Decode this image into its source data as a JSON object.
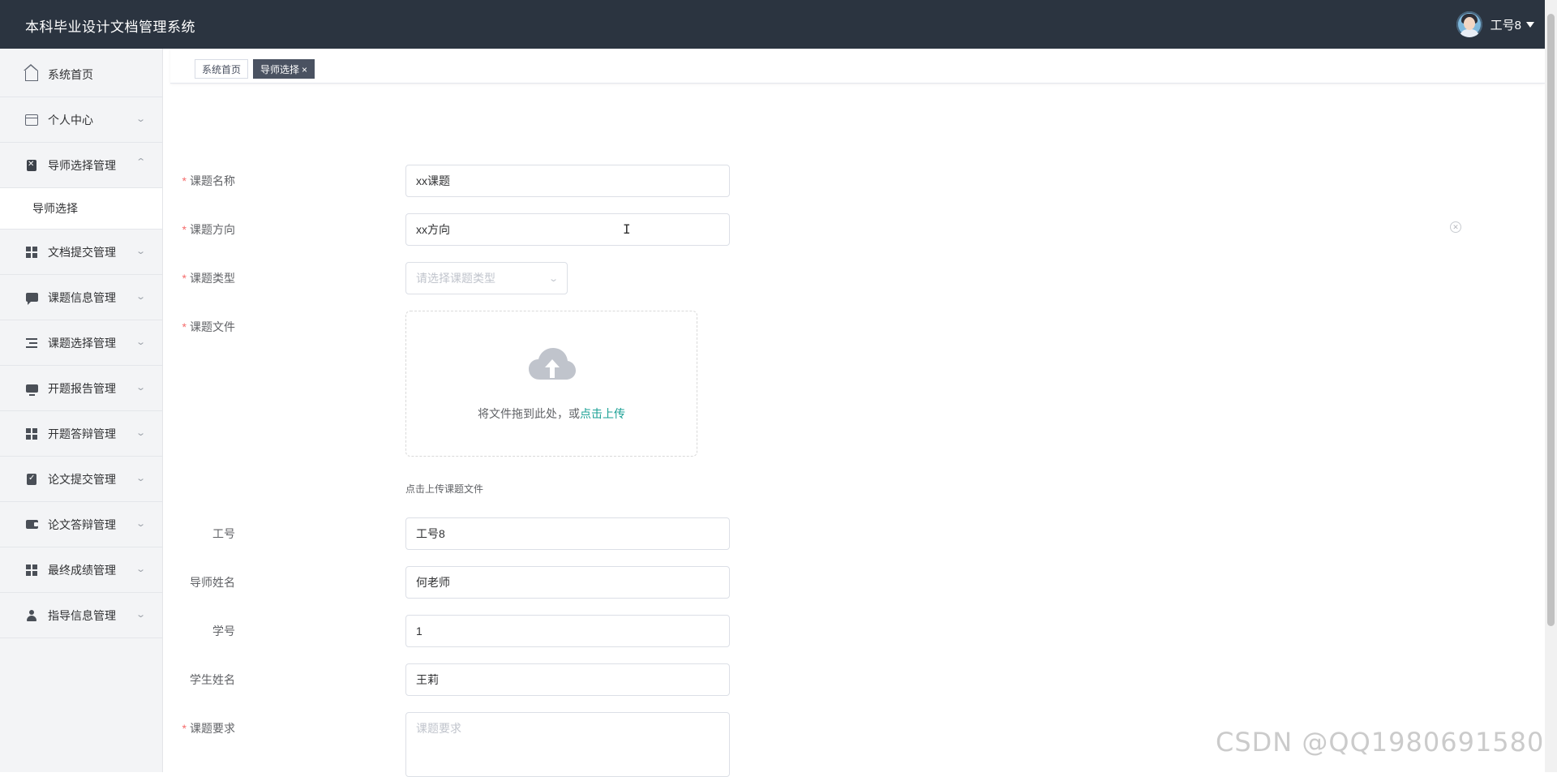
{
  "app": {
    "title": "本科毕业设计文档管理系统"
  },
  "user": {
    "name": "工号8"
  },
  "sidebar": {
    "items": [
      {
        "label": "系统首页",
        "icon": "home-icon",
        "expandable": false
      },
      {
        "label": "个人中心",
        "icon": "card-icon",
        "expandable": true
      },
      {
        "label": "导师选择管理",
        "icon": "clipboard-icon",
        "expandable": true,
        "expanded": true,
        "children": [
          {
            "label": "导师选择"
          }
        ]
      },
      {
        "label": "文档提交管理",
        "icon": "grid-icon",
        "expandable": true
      },
      {
        "label": "课题信息管理",
        "icon": "chat-icon",
        "expandable": true
      },
      {
        "label": "课题选择管理",
        "icon": "list-icon",
        "expandable": true
      },
      {
        "label": "开题报告管理",
        "icon": "monitor-icon",
        "expandable": true
      },
      {
        "label": "开题答辩管理",
        "icon": "grid-icon",
        "expandable": true
      },
      {
        "label": "论文提交管理",
        "icon": "check-clipboard-icon",
        "expandable": true
      },
      {
        "label": "论文答辩管理",
        "icon": "wallet-icon",
        "expandable": true
      },
      {
        "label": "最终成绩管理",
        "icon": "grid-icon",
        "expandable": true
      },
      {
        "label": "指导信息管理",
        "icon": "user-icon",
        "expandable": true
      }
    ]
  },
  "tabs": [
    {
      "label": "系统首页",
      "active": false
    },
    {
      "label": "导师选择",
      "active": true,
      "close": "×"
    }
  ],
  "form": {
    "topic_name": {
      "label": "课题名称",
      "required": true,
      "value": "xx课题"
    },
    "topic_direction": {
      "label": "课题方向",
      "required": true,
      "value": "xx方向"
    },
    "topic_type": {
      "label": "课题类型",
      "required": true,
      "placeholder": "请选择课题类型"
    },
    "topic_file": {
      "label": "课题文件",
      "required": true,
      "drop_text": "将文件拖到此处，或",
      "click_text": "点击上传",
      "tip": "点击上传课题文件"
    },
    "staff_id": {
      "label": "工号",
      "value": "工号8"
    },
    "teacher_name": {
      "label": "导师姓名",
      "value": "何老师"
    },
    "student_id": {
      "label": "学号",
      "value": "1"
    },
    "student_name": {
      "label": "学生姓名",
      "value": "王莉"
    },
    "requirements": {
      "label": "课题要求",
      "required": true,
      "placeholder": "课题要求"
    }
  },
  "watermark": "CSDN @QQ1980691580",
  "colors": {
    "topbar": "#2b3440",
    "accent": "#1aa094",
    "required": "#f56c6c",
    "active_tab": "#4a5261"
  }
}
